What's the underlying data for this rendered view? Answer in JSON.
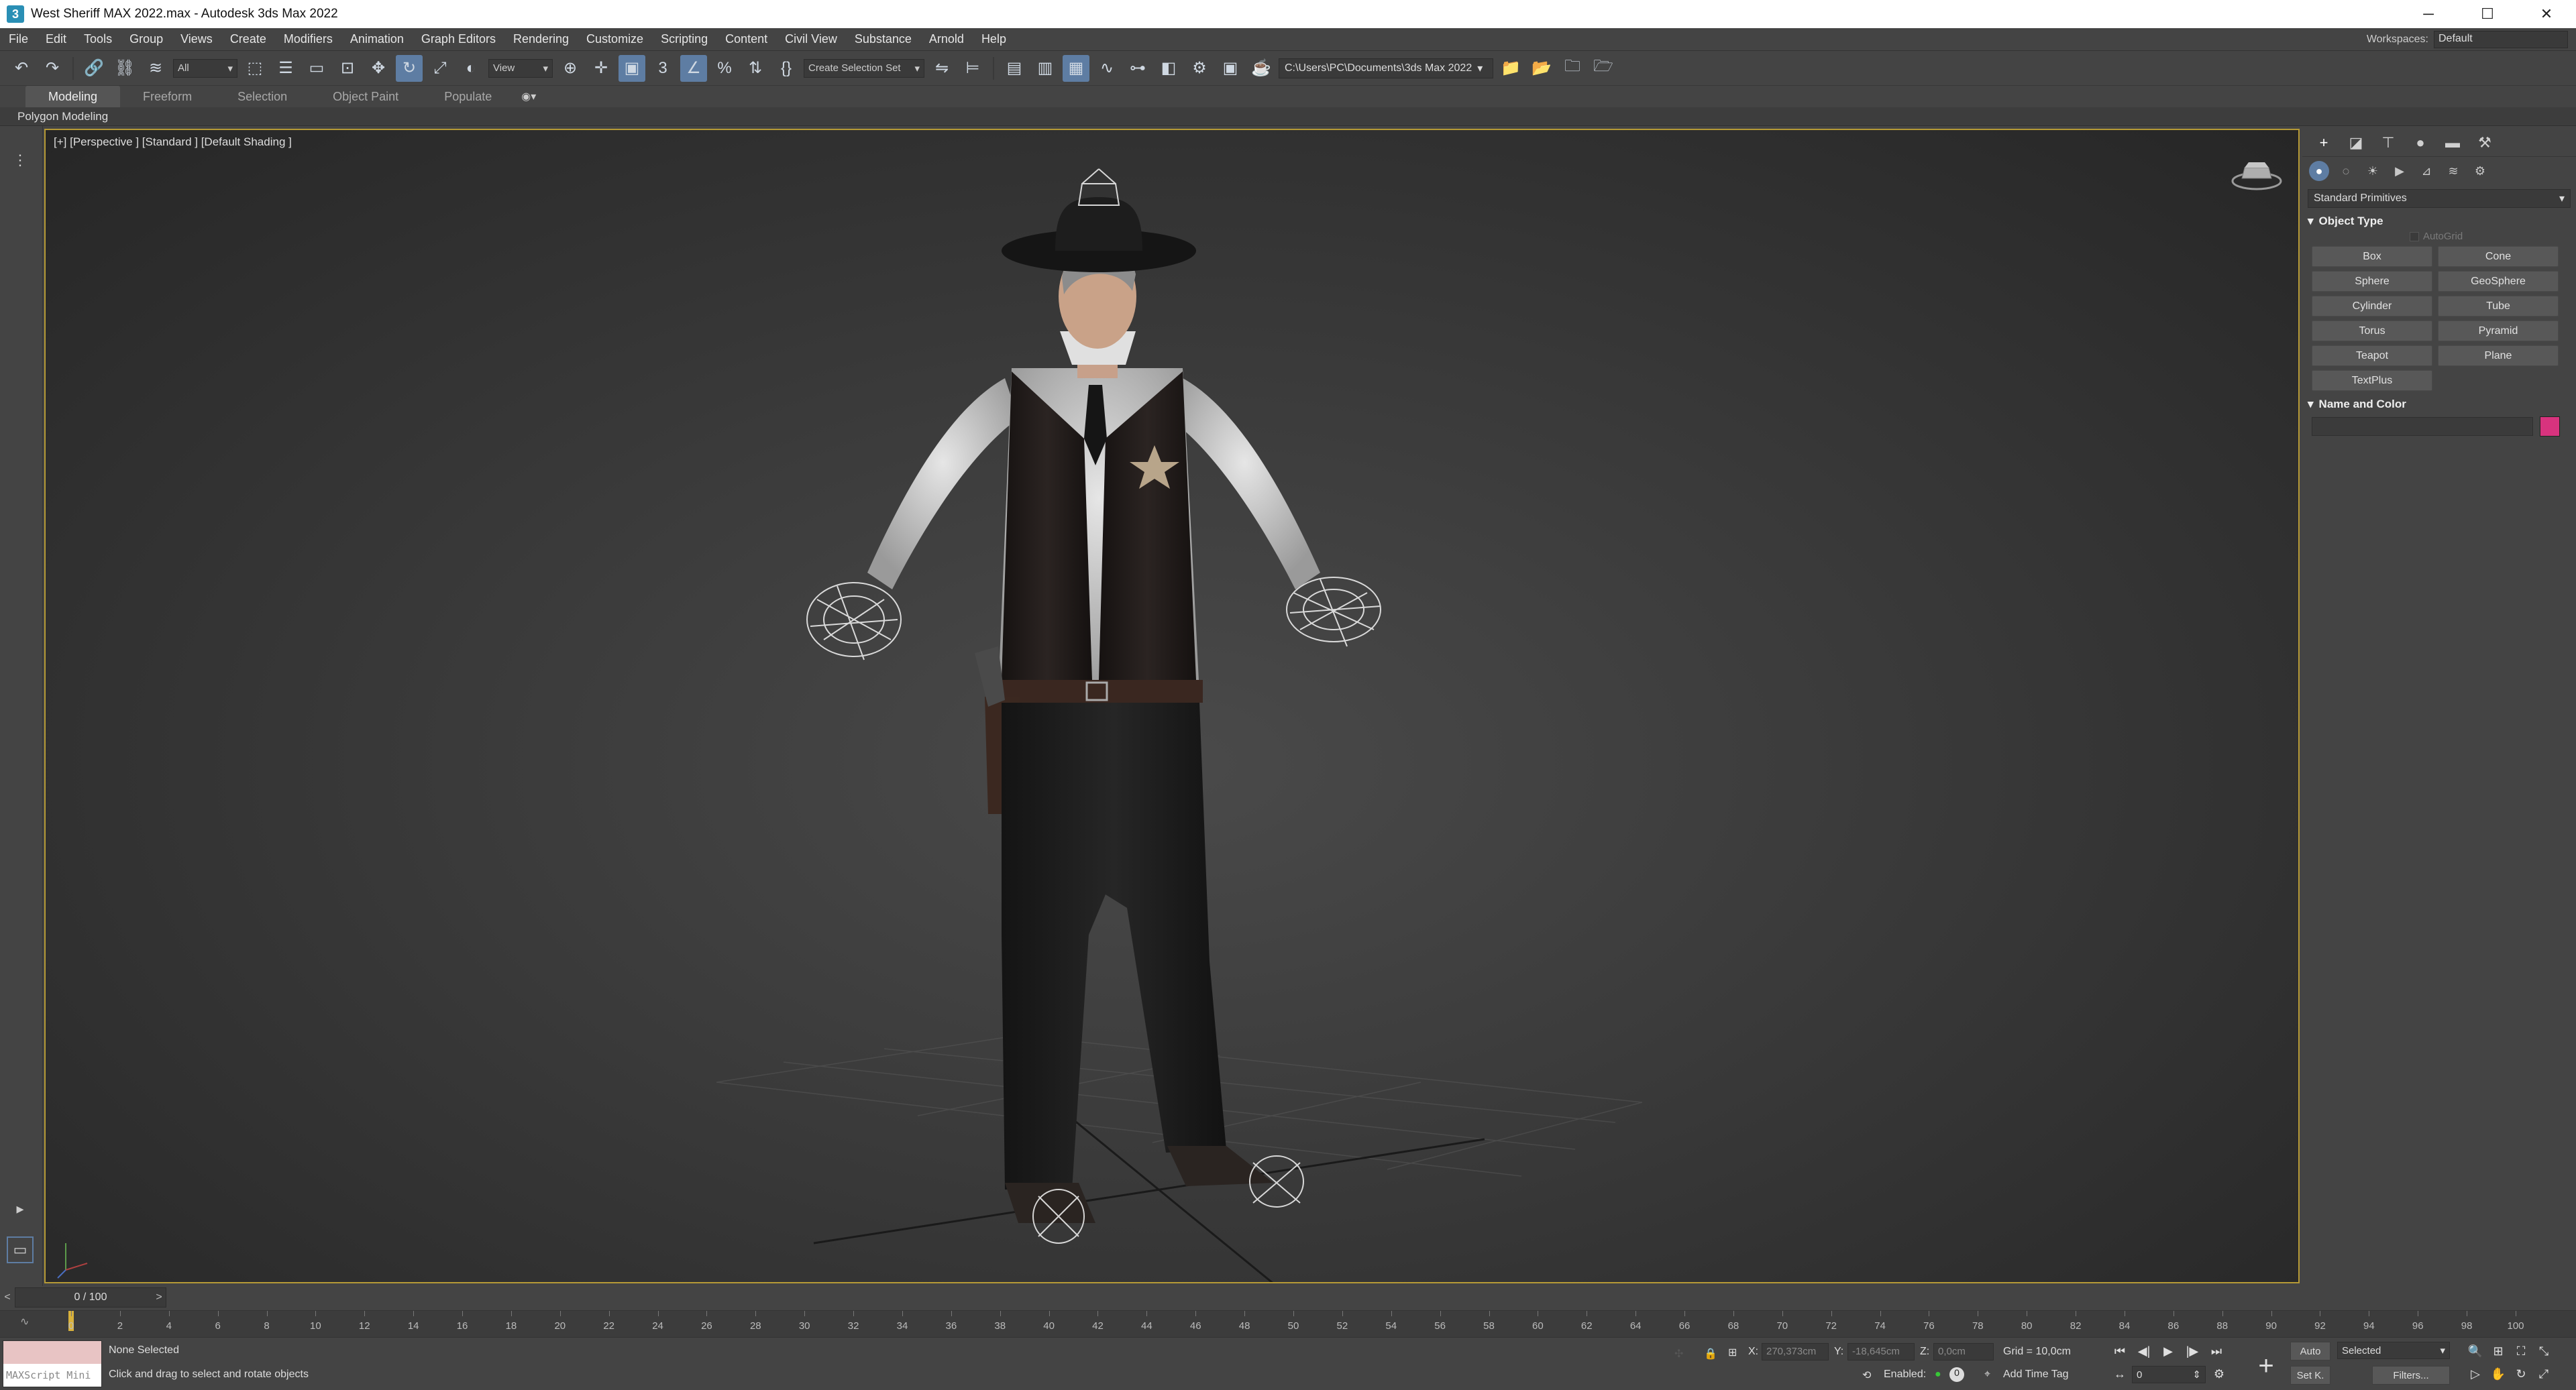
{
  "window": {
    "title": "West Sheriff MAX 2022.max - Autodesk 3ds Max 2022",
    "app_icon": "3ds-max-icon"
  },
  "menu": [
    "File",
    "Edit",
    "Tools",
    "Group",
    "Views",
    "Create",
    "Modifiers",
    "Animation",
    "Graph Editors",
    "Rendering",
    "Customize",
    "Scripting",
    "Content",
    "Civil View",
    "Substance",
    "Arnold",
    "Help"
  ],
  "workspace": {
    "label": "Workspaces:",
    "value": "Default"
  },
  "toolbar": {
    "filter": "All",
    "ref_coord": "View",
    "selection_set": "Create Selection Set",
    "project_path": "C:\\Users\\PC\\Documents\\3ds Max 2022"
  },
  "ribbon": {
    "tabs": [
      "Modeling",
      "Freeform",
      "Selection",
      "Object Paint",
      "Populate"
    ],
    "active": "Modeling",
    "sub": "Polygon Modeling"
  },
  "viewport": {
    "label": "[+] [Perspective ] [Standard ] [Default Shading ]"
  },
  "command_panel": {
    "category": "Standard Primitives",
    "object_type_title": "Object Type",
    "autogrid": "AutoGrid",
    "primitives": [
      "Box",
      "Cone",
      "Sphere",
      "GeoSphere",
      "Cylinder",
      "Tube",
      "Torus",
      "Pyramid",
      "Teapot",
      "Plane",
      "TextPlus"
    ],
    "name_color_title": "Name and Color",
    "object_color": "#d8337e"
  },
  "timeline": {
    "slider": "0 / 100",
    "ticks": [
      "0",
      "2",
      "4",
      "6",
      "8",
      "10",
      "12",
      "14",
      "16",
      "18",
      "20",
      "22",
      "24",
      "26",
      "28",
      "30",
      "32",
      "34",
      "36",
      "38",
      "40",
      "42",
      "44",
      "46",
      "48",
      "50",
      "52",
      "54",
      "56",
      "58",
      "60",
      "62",
      "64",
      "66",
      "68",
      "70",
      "72",
      "74",
      "76",
      "78",
      "80",
      "82",
      "84",
      "86",
      "88",
      "90",
      "92",
      "94",
      "96",
      "98",
      "100"
    ]
  },
  "status": {
    "maxscript": "MAXScript Mini",
    "selection": "None Selected",
    "prompt": "Click and drag to select and rotate objects",
    "x_label": "X:",
    "x_value": "270,373cm",
    "y_label": "Y:",
    "y_value": "-18,645cm",
    "z_label": "Z:",
    "z_value": "0,0cm",
    "grid": "Grid = 10,0cm",
    "enabled": "Enabled:",
    "add_time_tag": "Add Time Tag",
    "auto_key": "Auto",
    "set_key": "Set K.",
    "key_mode": "Selected",
    "filters": "Filters...",
    "frame": "0"
  }
}
